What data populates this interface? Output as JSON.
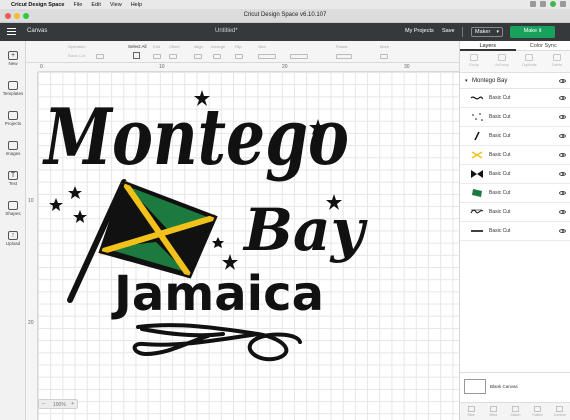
{
  "menubar": {
    "app_name": "Cricut Design Space",
    "items": [
      "File",
      "Edit",
      "View",
      "Help"
    ]
  },
  "window": {
    "title": "Cricut Design Space  v6.10.107"
  },
  "header": {
    "canvas_label": "Canvas",
    "doc_title": "Untitled*",
    "my_projects": "My Projects",
    "save": "Save",
    "machine": "Maker",
    "make_it": "Make it"
  },
  "toolbar": {
    "operation": {
      "label": "Operation",
      "value": "Basic Cut"
    },
    "select_all": "Select All",
    "edit": "Edit",
    "offset": "Offset",
    "align": "Align",
    "arrange": "Arrange",
    "flip": "Flip",
    "size": "Size",
    "rotate": "Rotate",
    "more": "More"
  },
  "sidebar": {
    "items": [
      "New",
      "Templates",
      "Projects",
      "Images",
      "Text",
      "Shapes",
      "Upload"
    ]
  },
  "ruler": {
    "x": [
      "0",
      "10",
      "20",
      "30"
    ],
    "y": [
      "10",
      "20"
    ]
  },
  "panel": {
    "tabs": [
      "Layers",
      "Color Sync"
    ],
    "actions": [
      "Group",
      "UnGroup",
      "Duplicate",
      "Delete"
    ],
    "group_name": "Montego Bay",
    "layers": [
      "Basic Cut",
      "Basic Cut",
      "Basic Cut",
      "Basic Cut",
      "Basic Cut",
      "Basic Cut",
      "Basic Cut",
      "Basic Cut"
    ],
    "blank_canvas": "Blank Canvas",
    "bottom_actions": [
      "Slice",
      "Weld",
      "Attach",
      "Flatten",
      "Contour"
    ]
  },
  "zoom": {
    "minus": "–",
    "value": "100%",
    "plus": "+"
  },
  "design": {
    "line1": "Montego",
    "line2": "Bay",
    "line3": "Jamaica",
    "flag_colors": {
      "green": "#1c7a3e",
      "gold": "#f2c21a",
      "black": "#111111"
    }
  }
}
